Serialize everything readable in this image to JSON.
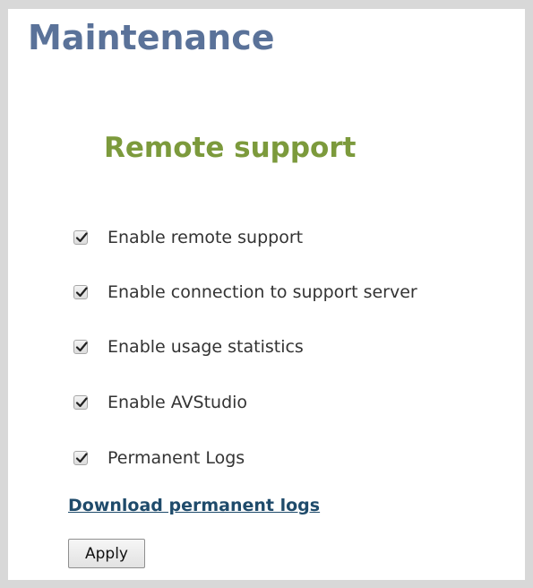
{
  "page": {
    "title": "Maintenance"
  },
  "remote_support": {
    "title": "Remote support",
    "options": [
      {
        "label": "Enable remote support",
        "checked": true
      },
      {
        "label": "Enable connection to support server",
        "checked": true
      },
      {
        "label": "Enable usage statistics",
        "checked": true
      },
      {
        "label": "Enable AVStudio",
        "checked": true
      },
      {
        "label": "Permanent Logs",
        "checked": true
      }
    ],
    "download_link": "Download permanent logs",
    "apply_label": "Apply"
  },
  "colors": {
    "page_title": "#5a7299",
    "section_title": "#7c9a3c",
    "link": "#1f4b6b"
  }
}
